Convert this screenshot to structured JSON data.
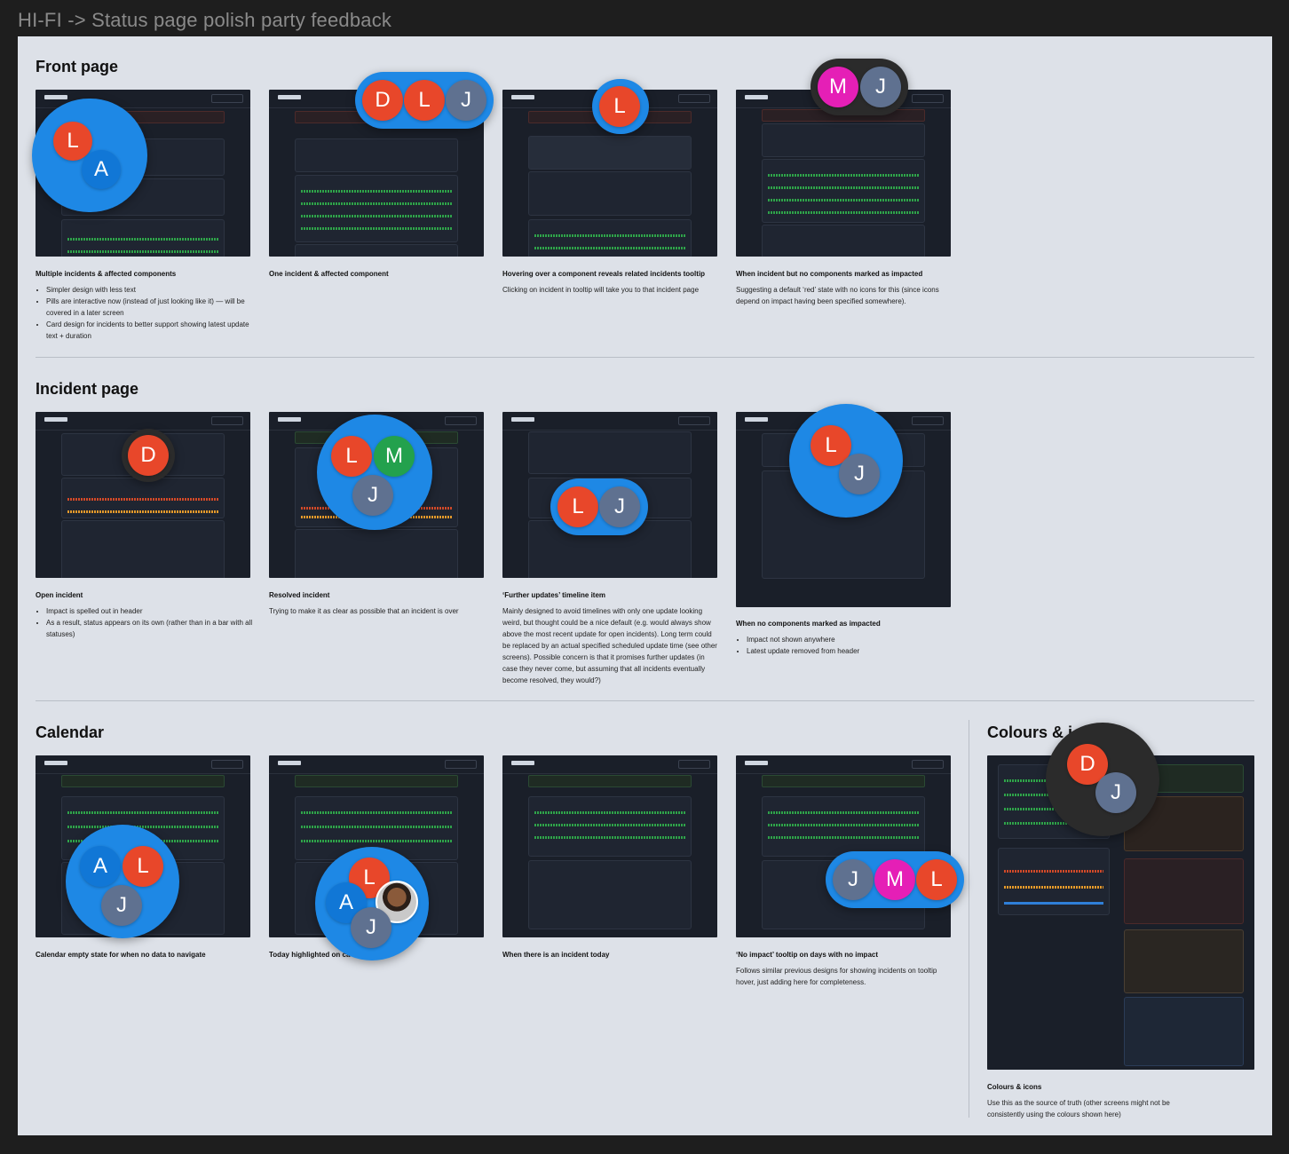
{
  "frame_title": "HI-FI -> Status page polish party feedback",
  "sections": {
    "front": {
      "title": "Front page",
      "items": [
        {
          "caption": "Multiple incidents & affected components",
          "bullets": [
            "Simpler design with less text",
            "Pills are interactive now (instead of just looking like it) — will be covered in a later screen",
            "Card design for incidents to better support showing latest update text + duration"
          ]
        },
        {
          "caption": "One incident & affected component"
        },
        {
          "caption": "Hovering over a component reveals related incidents tooltip",
          "text": "Clicking on incident in tooltip will take you to that incident page"
        },
        {
          "caption": "When incident but no components marked as impacted",
          "text": "Suggesting a default ‘red’ state with no icons for this (since icons depend on impact having been specified somewhere)."
        }
      ]
    },
    "incident": {
      "title": "Incident page",
      "items": [
        {
          "caption": "Open incident",
          "bullets": [
            "Impact is spelled out in header",
            "As a result, status appears on its own (rather than in a bar with all statuses)"
          ]
        },
        {
          "caption": "Resolved incident",
          "text": "Trying to make it as clear as possible that an incident is over"
        },
        {
          "caption": "‘Further updates’ timeline item",
          "text": "Mainly designed to avoid timelines with only one update looking weird, but thought could be a nice default (e.g. would always show above the most recent update for open incidents). Long term could be replaced by an actual specified scheduled update time (see other screens). Possible concern is that it promises further updates (in case they never come, but assuming that all incidents eventually become resolved, they would?)"
        },
        {
          "caption": "When no components marked as impacted",
          "bullets": [
            "Impact not shown anywhere",
            "Latest update removed from header"
          ]
        }
      ]
    },
    "calendar": {
      "title": "Calendar",
      "items": [
        {
          "caption": "Calendar empty state for when no data to navigate"
        },
        {
          "caption": "Today highlighted on ca"
        },
        {
          "caption": "When there is an incident today"
        },
        {
          "caption": "‘No impact’ tooltip on days with no impact",
          "text": "Follows similar previous designs for showing incidents on tooltip hover, just adding here for completeness."
        }
      ]
    },
    "colours": {
      "title": "Colours & i",
      "caption": "Colours & icons",
      "text": "Use this as the source of truth (other screens might not be consistently using the colours shown here)"
    }
  },
  "presence": {
    "p1": [
      "L",
      "A"
    ],
    "p2": [
      "D",
      "L",
      "J"
    ],
    "p3": [
      "L"
    ],
    "p4": [
      "M",
      "J"
    ],
    "p5": [
      "D"
    ],
    "p6": [
      "L",
      "M",
      "J"
    ],
    "p7": [
      "L",
      "J"
    ],
    "p8": [
      "L",
      "J"
    ],
    "p9": [
      "A",
      "L",
      "J"
    ],
    "p10": [
      "L",
      "A",
      "J"
    ],
    "p11": [
      "J",
      "M",
      "L"
    ],
    "p12": [
      "D",
      "J"
    ]
  },
  "colors": {
    "board": "#dde1e8",
    "presence_blue": "#1e88e5",
    "avatar_orange": "#e8472a",
    "avatar_slate": "#5f7190",
    "avatar_green": "#23a14d",
    "avatar_magenta": "#e51fb6",
    "status_green": "#2fa34b",
    "status_red": "#d04a2a",
    "status_amber": "#e59a2c"
  }
}
